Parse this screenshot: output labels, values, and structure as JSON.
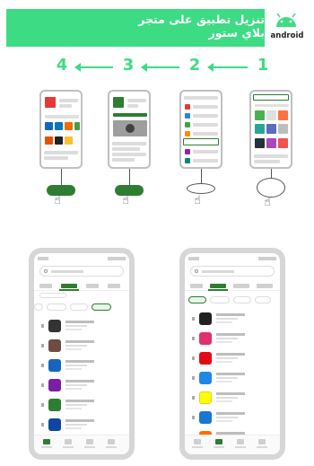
{
  "banner": {
    "title_line1": "تنزيل تطبيق على متجر",
    "title_line2": "بلاي ستور",
    "logo_text": "android",
    "logo_icon": "android-robot-icon",
    "accent_color": "#3ddc84"
  },
  "steps": {
    "labels": [
      "4",
      "3",
      "2",
      "1"
    ],
    "arrow_icon": "arrow-left-icon"
  },
  "step_phones": {
    "hand_icon": "pointing-hand-icon"
  }
}
